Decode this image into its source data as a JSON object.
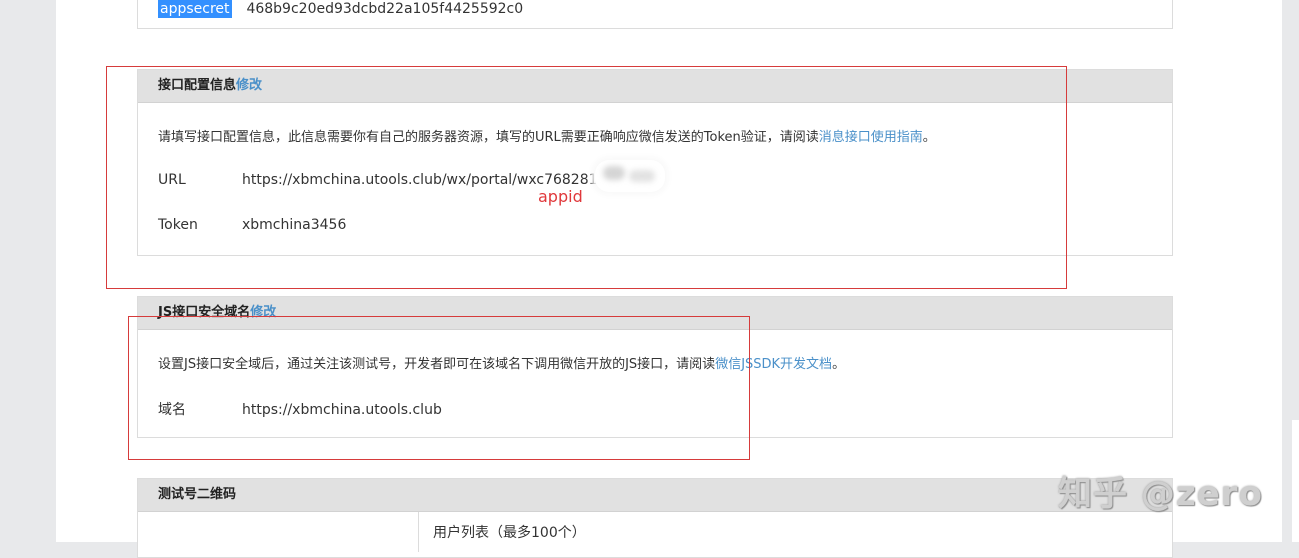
{
  "app_info": {
    "appsecret_key": "appsecret",
    "appsecret_value": "468b9c20ed93dcbd22a105f4425592c0"
  },
  "interface_config": {
    "title": "接口配置信息",
    "edit_label": "修改",
    "description_prefix": "请填写接口配置信息，此信息需要你有自己的服务器资源，填写的URL需要正确响应微信发送的Token验证，请阅读",
    "description_link": "消息接口使用指南",
    "description_suffix": "。",
    "url_key": "URL",
    "url_value": "https://xbmchina.utools.club/wx/portal/wxc768281",
    "token_key": "Token",
    "token_value": "xbmchina3456"
  },
  "annotation": {
    "appid_note": "appid"
  },
  "js_domain": {
    "title": "JS接口安全域名",
    "edit_label": "修改",
    "description_prefix": "设置JS接口安全域后，通过关注该测试号，开发者即可在该域名下调用微信开放的JS接口，请阅读",
    "description_link": "微信JSSDK开发文档",
    "description_suffix": "。",
    "domain_key": "域名",
    "domain_value": "https://xbmchina.utools.club"
  },
  "qr_section": {
    "title": "测试号二维码",
    "user_list_label": "用户列表（最多100个）"
  },
  "watermark": {
    "text": "知乎 @zero"
  },
  "colors": {
    "link": "#4a90c9",
    "annotation_red": "#d63b3b",
    "header_bg": "#e1e1e1"
  }
}
